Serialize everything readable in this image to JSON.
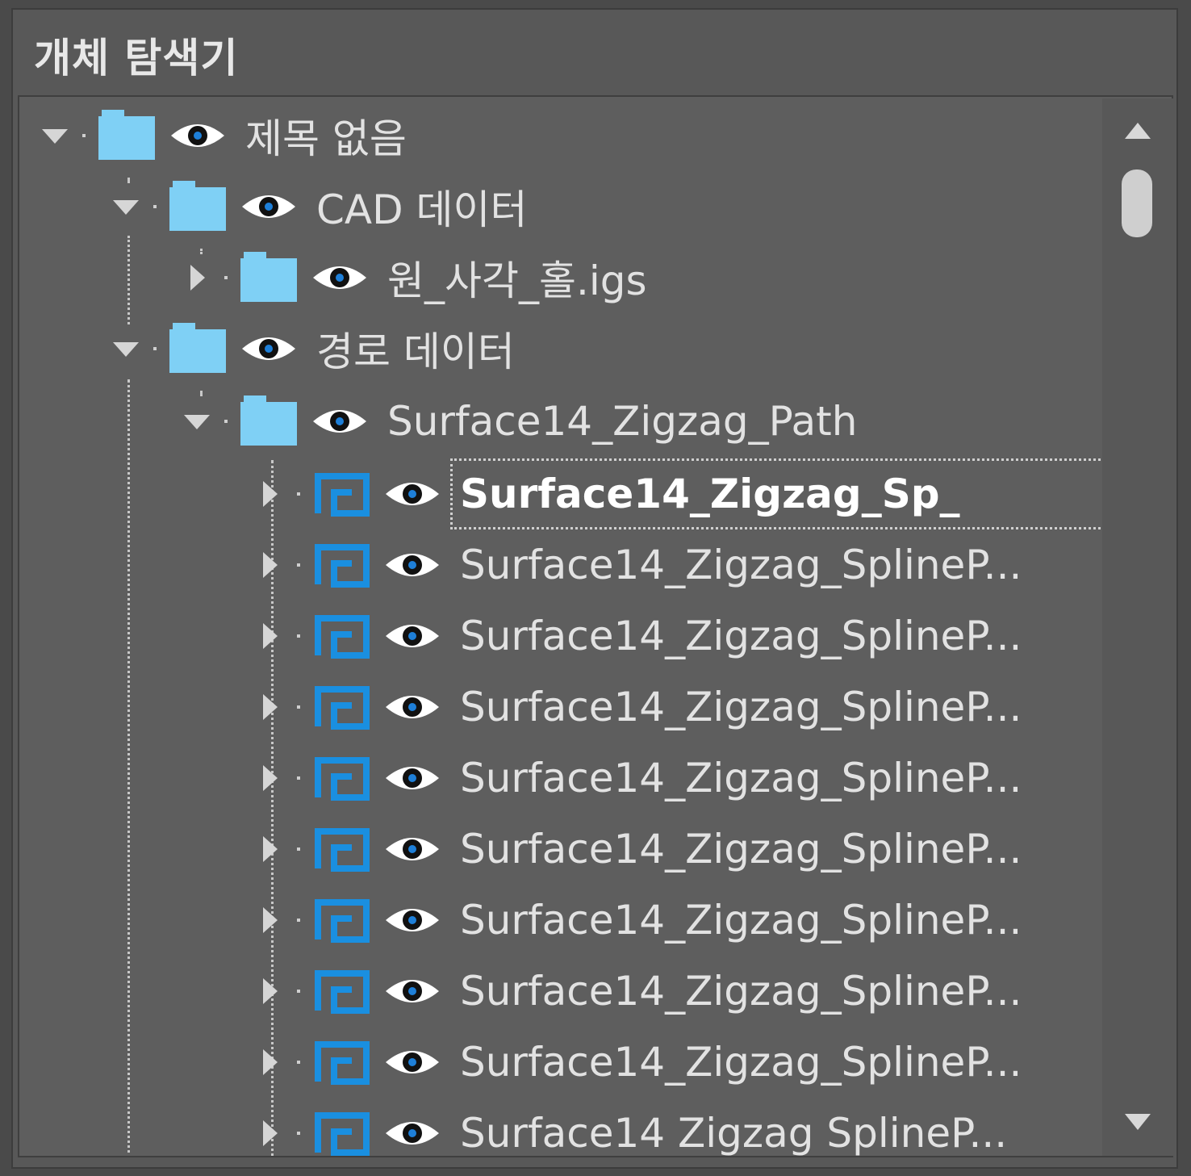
{
  "panel": {
    "title": "개체 탐색기"
  },
  "tree": {
    "root": {
      "label": "제목 없음"
    },
    "cad_data": {
      "label": "CAD 데이터"
    },
    "cad_file": {
      "label": "원_사각_홀.igs"
    },
    "path_data": {
      "label": "경로 데이터"
    },
    "path_group": {
      "label": "Surface14_Zigzag_Path"
    },
    "spline_items": [
      {
        "label": "Surface14_Zigzag_Sp_"
      },
      {
        "label": "Surface14_Zigzag_SplineP..."
      },
      {
        "label": "Surface14_Zigzag_SplineP..."
      },
      {
        "label": "Surface14_Zigzag_SplineP..."
      },
      {
        "label": "Surface14_Zigzag_SplineP..."
      },
      {
        "label": "Surface14_Zigzag_SplineP..."
      },
      {
        "label": "Surface14_Zigzag_SplineP..."
      },
      {
        "label": "Surface14_Zigzag_SplineP..."
      },
      {
        "label": "Surface14_Zigzag_SplineP..."
      },
      {
        "label": "Surface14 Zigzag SplineP..."
      }
    ]
  },
  "colors": {
    "folder": "#7fd0f5",
    "path_icon": "#1a8fe0",
    "background": "#5e5e5e"
  }
}
